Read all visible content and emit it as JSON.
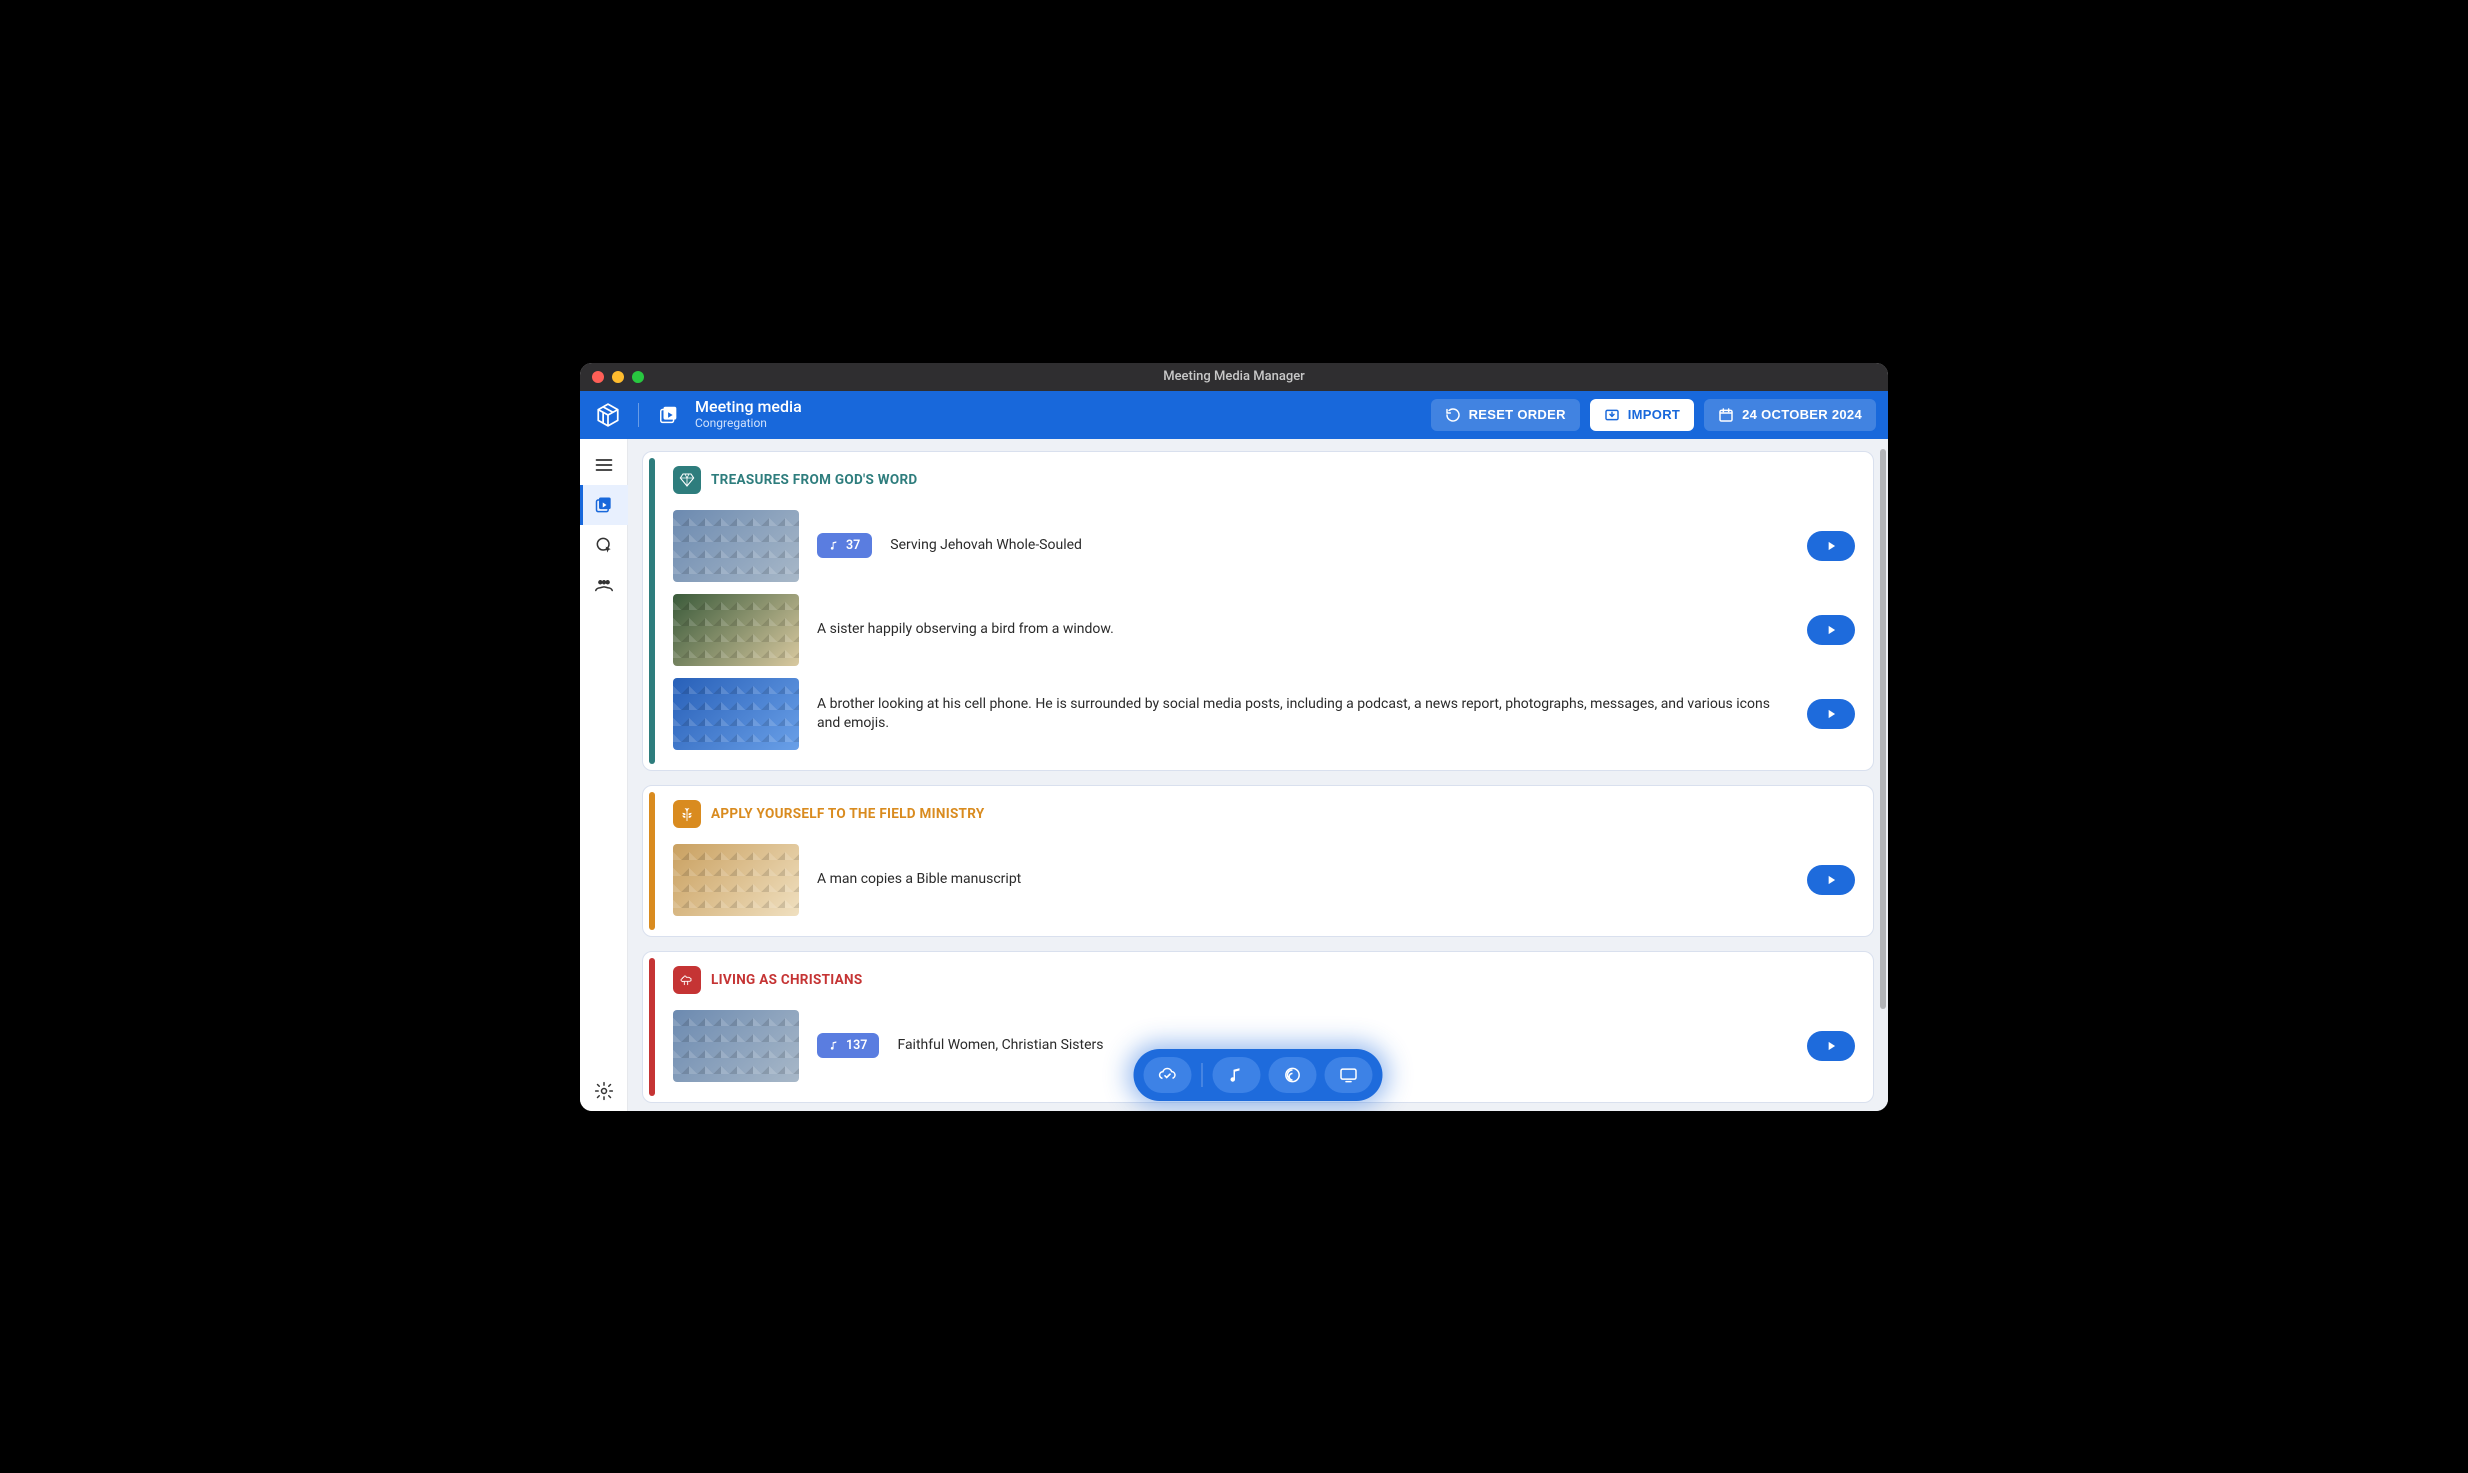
{
  "window": {
    "title": "Meeting Media Manager"
  },
  "appbar": {
    "title": "Meeting media",
    "subtitle": "Congregation",
    "reset_label": "RESET ORDER",
    "import_label": "IMPORT",
    "date_label": "24 OCTOBER 2024"
  },
  "sections": [
    {
      "id": "treasures",
      "title": "TREASURES FROM GOD'S WORD",
      "color_class": "teal",
      "icon": "diamond-icon",
      "items": [
        {
          "thumb_class": "v1",
          "song": "37",
          "text": "Serving Jehovah Whole-Souled"
        },
        {
          "thumb_class": "v2",
          "song": null,
          "text": "A sister happily observing a bird from a window."
        },
        {
          "thumb_class": "v3",
          "song": null,
          "text": "A brother looking at his cell phone. He is surrounded by social media posts, including a podcast, a news report, photographs, messages, and various icons and emojis."
        }
      ]
    },
    {
      "id": "apply",
      "title": "APPLY YOURSELF TO THE FIELD MINISTRY",
      "color_class": "amber",
      "icon": "wheat-icon",
      "items": [
        {
          "thumb_class": "v4",
          "song": null,
          "text": "A man copies a Bible manuscript"
        }
      ]
    },
    {
      "id": "living",
      "title": "LIVING AS CHRISTIANS",
      "color_class": "crimson",
      "icon": "sheep-icon",
      "items": [
        {
          "thumb_class": "v5",
          "song": "137",
          "text": "Faithful Women, Christian Sisters"
        }
      ]
    }
  ]
}
